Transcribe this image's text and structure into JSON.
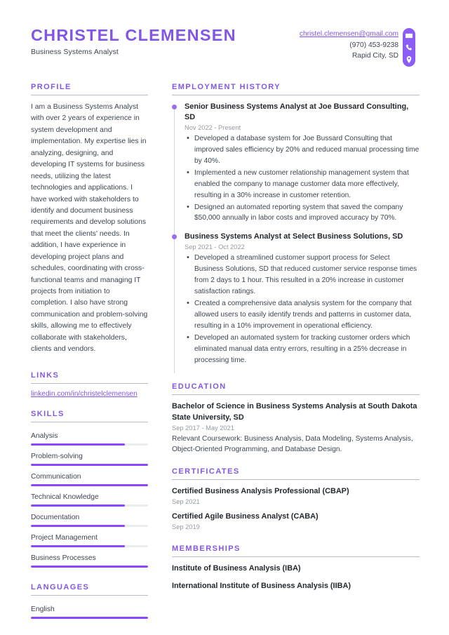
{
  "header": {
    "full_name": "CHRISTEL CLEMENSEN",
    "job_title": "Business Systems Analyst",
    "email": "christel.clemensen@gmail.com",
    "phone": "(970) 453-9238",
    "location": "Rapid City, SD",
    "icons": [
      "envelope-icon",
      "phone-icon",
      "location-pin-icon"
    ]
  },
  "colors": {
    "accent_purple": "#8257e6",
    "bar_purple": "#8b46ff",
    "rail_purple": "#8b5cf6",
    "dot_purple": "#9b6ef0",
    "body_text": "#3d4552",
    "muted_text": "#9399a3",
    "track_gray": "#eceded",
    "rule_gray": "#b9bcc4"
  },
  "left": {
    "profile": {
      "title": "PROFILE",
      "text": "I am a Business Systems Analyst with over 2 years of experience in system development and implementation. My expertise lies in analyzing, designing, and developing IT systems for business needs, utilizing the latest technologies and applications. I have worked with stakeholders to identify and document business requirements and develop solutions that meet the clients' needs. In addition, I have experience in developing project plans and schedules, coordinating with cross-functional teams and managing IT projects from initiation to completion. I also have strong communication and problem-solving skills, allowing me to effectively collaborate with stakeholders, clients and vendors."
    },
    "links": {
      "title": "LINKS",
      "items": [
        {
          "label": "linkedin.com/in/christelclemensen"
        }
      ]
    },
    "skills": {
      "title": "SKILLS",
      "items": [
        {
          "name": "Analysis",
          "level": 80
        },
        {
          "name": "Problem-solving",
          "level": 100
        },
        {
          "name": "Communication",
          "level": 100
        },
        {
          "name": "Technical Knowledge",
          "level": 80
        },
        {
          "name": "Documentation",
          "level": 80
        },
        {
          "name": "Project Management",
          "level": 80
        },
        {
          "name": "Business Processes",
          "level": 100
        }
      ]
    },
    "languages": {
      "title": "LANGUAGES",
      "items": [
        {
          "name": "English",
          "level": 100
        }
      ]
    }
  },
  "right": {
    "employment": {
      "title": "EMPLOYMENT HISTORY",
      "jobs": [
        {
          "title": "Senior Business Systems Analyst at Joe Bussard Consulting, SD",
          "date": "Nov 2022 - Present",
          "bullets": [
            "Developed a database system for Joe Bussard Consulting that improved sales efficiency by 20% and reduced manual processing time by 40%.",
            "Implemented a new customer relationship management system that enabled the company to manage customer data more effectively, resulting in a 30% increase in customer retention.",
            "Designed an automated reporting system that saved the company $50,000 annually in labor costs and improved accuracy by 70%."
          ]
        },
        {
          "title": "Business Systems Analyst at Select Business Solutions, SD",
          "date": "Sep 2021 - Oct 2022",
          "bullets": [
            "Developed a streamlined customer support process for Select Business Solutions, SD that reduced customer service response times from 2 days to 1 hour. This resulted in a 20% increase in customer satisfaction ratings.",
            "Created a comprehensive data analysis system for the company that allowed users to easily identify trends and patterns in customer data, resulting in a 10% improvement in operational efficiency.",
            "Developed an automated system for tracking customer orders which eliminated manual data entry errors, resulting in a 25% decrease in processing time."
          ]
        }
      ]
    },
    "education": {
      "title": "EDUCATION",
      "items": [
        {
          "title": "Bachelor of Science in Business Systems Analysis at South Dakota State University, SD",
          "date": "Sep 2017 - May 2021",
          "description": "Relevant Coursework: Business Analysis, Data Modeling, Systems Analysis, Object-Oriented Programming, and Database Design."
        }
      ]
    },
    "certificates": {
      "title": "CERTIFICATES",
      "items": [
        {
          "title": "Certified Business Analysis Professional (CBAP)",
          "date": "Sep 2021"
        },
        {
          "title": "Certified Agile Business Analyst (CABA)",
          "date": "Sep 2019"
        }
      ]
    },
    "memberships": {
      "title": "MEMBERSHIPS",
      "items": [
        {
          "title": "Institute of Business Analysis (IBA)"
        },
        {
          "title": "International Institute of Business Analysis (IIBA)"
        }
      ]
    }
  }
}
